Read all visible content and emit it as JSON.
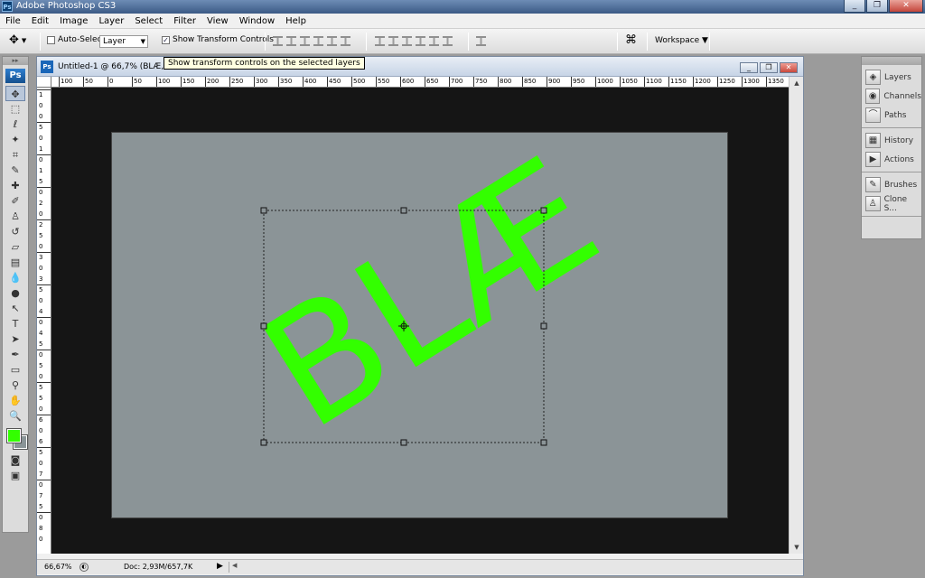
{
  "app": {
    "title": "Adobe Photoshop CS3",
    "logo": "Ps"
  },
  "window_controls": [
    "_",
    "❐",
    "✕"
  ],
  "menu": [
    "File",
    "Edit",
    "Image",
    "Layer",
    "Select",
    "Filter",
    "View",
    "Window",
    "Help"
  ],
  "options": {
    "auto_select_label": "Auto-Select:",
    "auto_select_checked": false,
    "layer_select_value": "Layer",
    "show_transform_label": "Show Transform Controls",
    "show_transform_checked": true,
    "workspace_label": "Workspace ▼"
  },
  "tooltip": "Show transform controls on the selected layers",
  "toolbox": {
    "logo": "Ps",
    "tools": [
      {
        "name": "move-tool",
        "glyph": "✥",
        "active": true
      },
      {
        "name": "marquee-tool",
        "glyph": "⬚"
      },
      {
        "name": "lasso-tool",
        "glyph": "ℓ"
      },
      {
        "name": "magic-wand-tool",
        "glyph": "✦"
      },
      {
        "name": "crop-tool",
        "glyph": "⌗"
      },
      {
        "name": "slice-tool",
        "glyph": "✎"
      },
      {
        "name": "healing-brush-tool",
        "glyph": "✚"
      },
      {
        "name": "brush-tool",
        "glyph": "✐"
      },
      {
        "name": "clone-stamp-tool",
        "glyph": "♙"
      },
      {
        "name": "history-brush-tool",
        "glyph": "↺"
      },
      {
        "name": "eraser-tool",
        "glyph": "▱"
      },
      {
        "name": "gradient-tool",
        "glyph": "▤"
      },
      {
        "name": "blur-tool",
        "glyph": "💧"
      },
      {
        "name": "dodge-tool",
        "glyph": "●"
      },
      {
        "name": "path-selection-tool",
        "glyph": "↖"
      },
      {
        "name": "type-tool",
        "glyph": "T"
      },
      {
        "name": "direct-selection-tool",
        "glyph": "➤"
      },
      {
        "name": "pen-tool",
        "glyph": "✒"
      },
      {
        "name": "notes-tool",
        "glyph": "▭"
      },
      {
        "name": "eyedropper-tool",
        "glyph": "⚲"
      },
      {
        "name": "hand-tool",
        "glyph": "✋"
      },
      {
        "name": "zoom-tool",
        "glyph": "🔍"
      }
    ],
    "fg_color": "#33ff00",
    "bg_color": "#8a9497"
  },
  "document": {
    "title": "Untitled-1 @ 66,7% (BLÆ, RGB/8)",
    "zoom": "66,67%",
    "doc_info": "Doc: 2,93M/657,7K",
    "text_layer": "BLÆ",
    "text_color": "#33ff00",
    "canvas_color": "#8b9497",
    "ruler_h": [
      "100",
      "50",
      "0",
      "50",
      "100",
      "150",
      "200",
      "250",
      "300",
      "350",
      "400",
      "450",
      "500",
      "550",
      "600",
      "650",
      "700",
      "750",
      "800",
      "850",
      "900",
      "950",
      "1000",
      "1050",
      "1100",
      "1150",
      "1200",
      "1250",
      "1300",
      "1350"
    ],
    "ruler_v": [
      "1",
      "0",
      "0",
      "5",
      "0",
      "1",
      "0",
      "1",
      "5",
      "0",
      "2",
      "0",
      "2",
      "5",
      "0",
      "3",
      "0",
      "3",
      "5",
      "0",
      "4",
      "0",
      "4",
      "5",
      "0",
      "5",
      "0",
      "5",
      "5",
      "0",
      "6",
      "0",
      "6",
      "5",
      "0",
      "7",
      "0",
      "7",
      "5",
      "0",
      "8",
      "0"
    ]
  },
  "panels": [
    [
      {
        "name": "layers",
        "label": "Layers",
        "glyph": "◈"
      },
      {
        "name": "channels",
        "label": "Channels",
        "glyph": "◉"
      },
      {
        "name": "paths",
        "label": "Paths",
        "glyph": "⌒"
      }
    ],
    [
      {
        "name": "history",
        "label": "History",
        "glyph": "▦"
      },
      {
        "name": "actions",
        "label": "Actions",
        "glyph": "▶"
      }
    ],
    [
      {
        "name": "brushes",
        "label": "Brushes",
        "glyph": "✎"
      },
      {
        "name": "clone-source",
        "label": "Clone S...",
        "glyph": "♙"
      }
    ]
  ]
}
